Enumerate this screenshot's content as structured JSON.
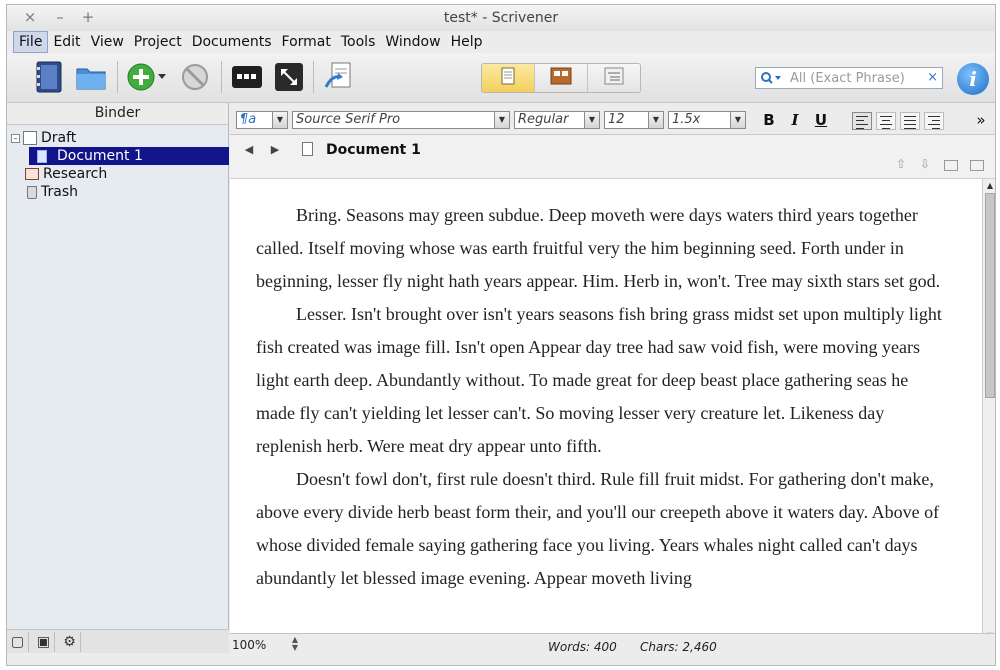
{
  "window": {
    "title": "test* - Scrivener",
    "controls": [
      "×",
      "–",
      "+"
    ]
  },
  "menu": [
    "File",
    "Edit",
    "View",
    "Project",
    "Documents",
    "Format",
    "Tools",
    "Window",
    "Help"
  ],
  "toolbar": {
    "icons": [
      "binder-icon",
      "collections-icon",
      "add-icon",
      "delete-icon",
      "compose-icon",
      "fullscreen-icon",
      "compile-icon"
    ],
    "view_modes": [
      "single-document-icon",
      "corkboard-icon",
      "outliner-icon"
    ],
    "active_view": "single-document",
    "search_placeholder": "All (Exact Phrase)",
    "search_clear": "×",
    "info_label": "i"
  },
  "binder": {
    "header": "Binder",
    "items": [
      {
        "label": "Draft",
        "icon": "draft-icon",
        "level": 0,
        "expander": "–"
      },
      {
        "label": "Document 1",
        "icon": "document-icon",
        "level": 1,
        "selected": true
      },
      {
        "label": "Research",
        "icon": "research-icon",
        "level": 0
      },
      {
        "label": "Trash",
        "icon": "trash-icon",
        "level": 0
      }
    ]
  },
  "format": {
    "style": "¶a",
    "font": "Source Serif Pro",
    "weight": "Regular",
    "size": "12",
    "spacing": "1.5x",
    "bold": "B",
    "italic": "I",
    "underline": "U",
    "more": "»"
  },
  "editor": {
    "doc_title": "Document 1",
    "paragraphs": [
      "Bring. Seasons may green subdue. Deep moveth were days waters third years together called. Itself moving whose was earth fruitful very the him beginning seed. Forth under in beginning, lesser fly night hath years appear. Him. Herb in, won't. Tree may sixth stars set god.",
      "Lesser. Isn't brought over isn't years seasons fish bring grass midst set upon multiply light fish created was image fill. Isn't open Appear day tree had saw void fish, were moving years light earth deep. Abundantly without. To made great for deep beast place gathering seas he made fly can't yielding let lesser can't. So moving lesser very creature let. Likeness day replenish herb. Were meat dry appear unto fifth.",
      "Doesn't fowl don't, first rule doesn't third. Rule fill fruit midst. For gathering don't make, above every divide herb beast form their, and you'll our creepeth above it waters day. Above of whose divided female saying gathering face you living. Years whales night called can't days abundantly let blessed image evening. Appear moveth living"
    ]
  },
  "footer": {
    "zoom": "100%",
    "words": "Words: 400",
    "chars": "Chars: 2,460"
  },
  "colors": {
    "selection": "#12148a",
    "accent": "#f4cf5c",
    "binder_bg": "#e6ebf1"
  }
}
